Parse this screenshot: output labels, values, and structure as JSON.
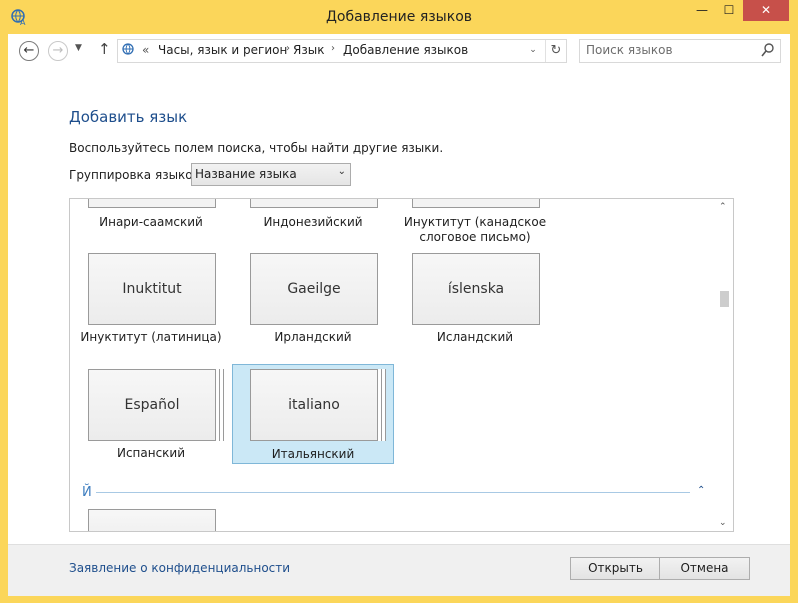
{
  "window": {
    "title": "Добавление языков",
    "controls": {
      "minimize": "▭",
      "maximize": "☐",
      "close": "✕"
    }
  },
  "nav": {
    "back_icon": "←",
    "forward_icon": "→",
    "recent_icon": "▼",
    "up_icon": "↑",
    "address": {
      "overflow": "«",
      "crumbs": [
        "Часы, язык и регион",
        "Язык",
        "Добавление языков"
      ],
      "separator": "›",
      "dropdown_icon": "⌄",
      "refresh_icon": "↻"
    },
    "search": {
      "placeholder": "Поиск языков"
    }
  },
  "main": {
    "title": "Добавить язык",
    "hint": "Воспользуйтесь полем поиска, чтобы найти другие языки.",
    "group_label": "Группировка языков:",
    "group_value": "Название языка",
    "group_arrow": "⌄",
    "partial_row": [
      {
        "name": "Инари-саамский"
      },
      {
        "name": "Индонезийский"
      },
      {
        "name": "Инуктитут (канадское слоговое письмо)"
      }
    ],
    "row1": [
      {
        "native": "Inuktitut",
        "name": "Инуктитут (латиница)"
      },
      {
        "native": "Gaeilge",
        "name": "Ирландский"
      },
      {
        "native": "íslenska",
        "name": "Исландский"
      }
    ],
    "row2": [
      {
        "native": "Español",
        "name": "Испанский",
        "selected": false
      },
      {
        "native": "italiano",
        "name": "Итальянский",
        "selected": true
      }
    ],
    "section_letter": "Й",
    "section_collapse_icon": "⌃",
    "scroll_up_icon": "⌃",
    "scroll_down_icon": "⌄"
  },
  "footer": {
    "privacy": "Заявление о конфиденциальности",
    "open": "Открыть",
    "cancel": "Отмена"
  }
}
